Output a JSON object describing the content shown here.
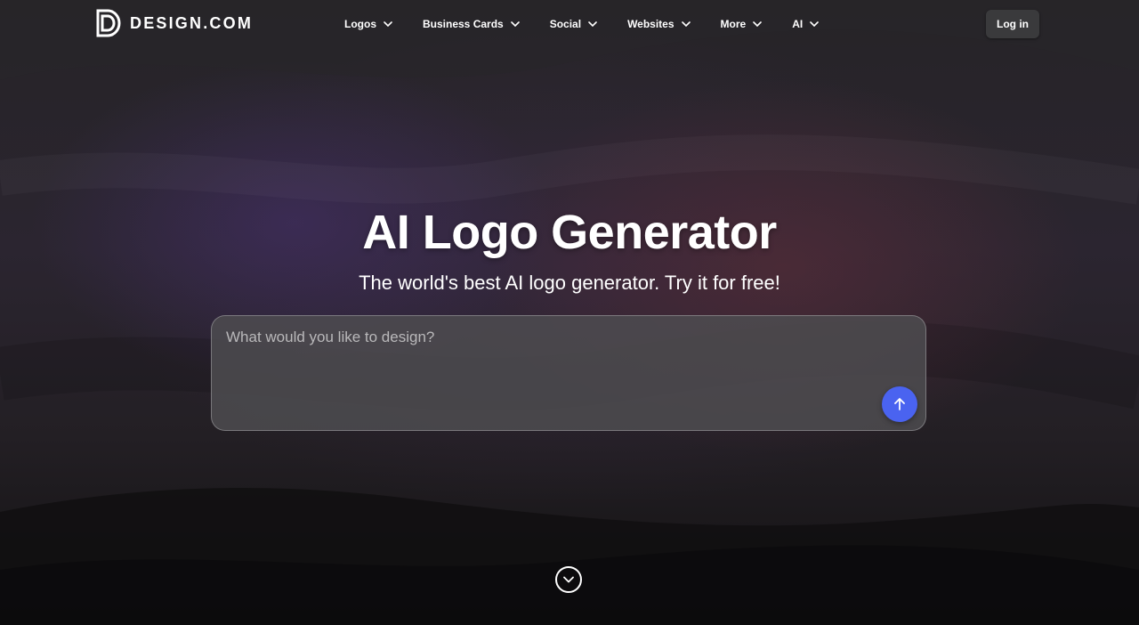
{
  "brand": {
    "name": "DESIGN.COM",
    "icon": "design-d-logo-icon"
  },
  "nav": {
    "items": [
      {
        "label": "Logos",
        "icon": "chevron-down-icon"
      },
      {
        "label": "Business Cards",
        "icon": "chevron-down-icon"
      },
      {
        "label": "Social",
        "icon": "chevron-down-icon"
      },
      {
        "label": "Websites",
        "icon": "chevron-down-icon"
      },
      {
        "label": "More",
        "icon": "chevron-down-icon"
      },
      {
        "label": "AI",
        "icon": "chevron-down-icon"
      }
    ],
    "login_label": "Log in"
  },
  "hero": {
    "title": "AI Logo Generator",
    "subtitle": "The world's best AI logo generator. Try it for free!",
    "prompt_placeholder": "What would you like to design?",
    "prompt_value": "",
    "submit_icon": "arrow-up-icon",
    "scroll_icon": "chevron-down-circle-icon"
  },
  "colors": {
    "accent": "#4a63f0",
    "login_bg": "#3a3a3c",
    "text": "#ffffff"
  }
}
